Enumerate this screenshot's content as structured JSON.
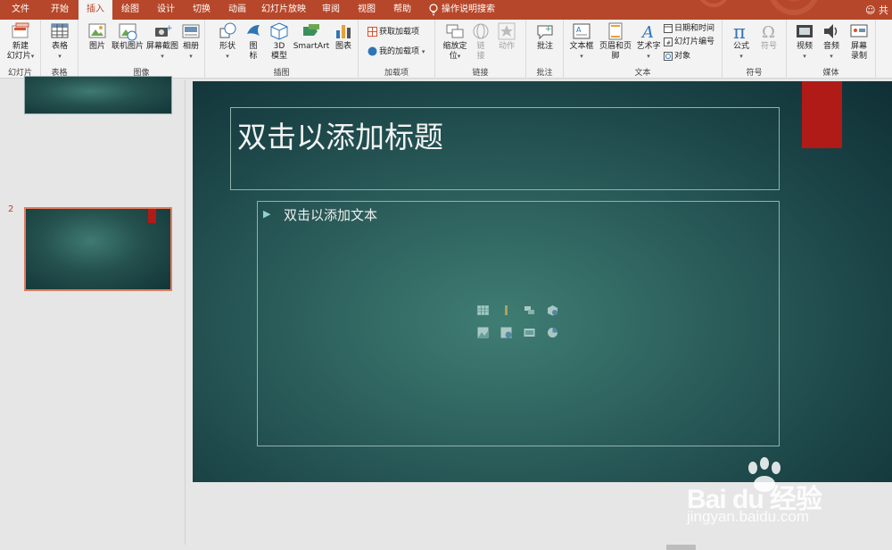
{
  "tabs": [
    "文件",
    "开始",
    "插入",
    "绘图",
    "设计",
    "切换",
    "动画",
    "幻灯片放映",
    "审阅",
    "视图",
    "帮助"
  ],
  "active_tab": "插入",
  "tell_me": "操作说明搜索",
  "user_fragment": "共",
  "groups": {
    "slides": {
      "label": "幻灯片",
      "new_slide": "新建\n幻灯片"
    },
    "tables": {
      "label": "表格",
      "table": "表格"
    },
    "images": {
      "label": "图像",
      "picture": "图片",
      "online_picture": "联机图片",
      "screenshot": "屏幕截图",
      "album": "相册"
    },
    "illustrations": {
      "label": "插图",
      "shapes": "形状",
      "icons": "图\n标",
      "model3d": "3D\n模型",
      "smartart": "SmartArt",
      "chart": "图表"
    },
    "addins": {
      "label": "加载项",
      "get_addins": "获取加载项",
      "my_addins": "我的加载项"
    },
    "links": {
      "label": "链接",
      "zoom": "缩放定\n位",
      "link": "链\n接",
      "action": "动作"
    },
    "comments": {
      "label": "批注",
      "comment": "批注"
    },
    "text": {
      "label": "文本",
      "textbox": "文本框",
      "header_footer": "页眉和页脚",
      "wordart": "艺术字",
      "date_time": "日期和时间",
      "slide_number": "幻灯片编号",
      "object": "对象"
    },
    "symbols": {
      "label": "符号",
      "equation": "公式",
      "symbol": "符号"
    },
    "media": {
      "label": "媒体",
      "video": "视频",
      "audio": "音频",
      "screen_recording": "屏幕\n录制"
    }
  },
  "thumbnails": {
    "current_number": "2"
  },
  "slide": {
    "title_placeholder": "双击以添加标题",
    "body_placeholder": "双击以添加文本"
  },
  "watermark": {
    "logo": "Bai du 经验",
    "url": "jingyan.baidu.com"
  },
  "colors": {
    "accent": "#b7472a",
    "slide_red": "#b01a17",
    "thumb_selected": "#e07a5f"
  }
}
